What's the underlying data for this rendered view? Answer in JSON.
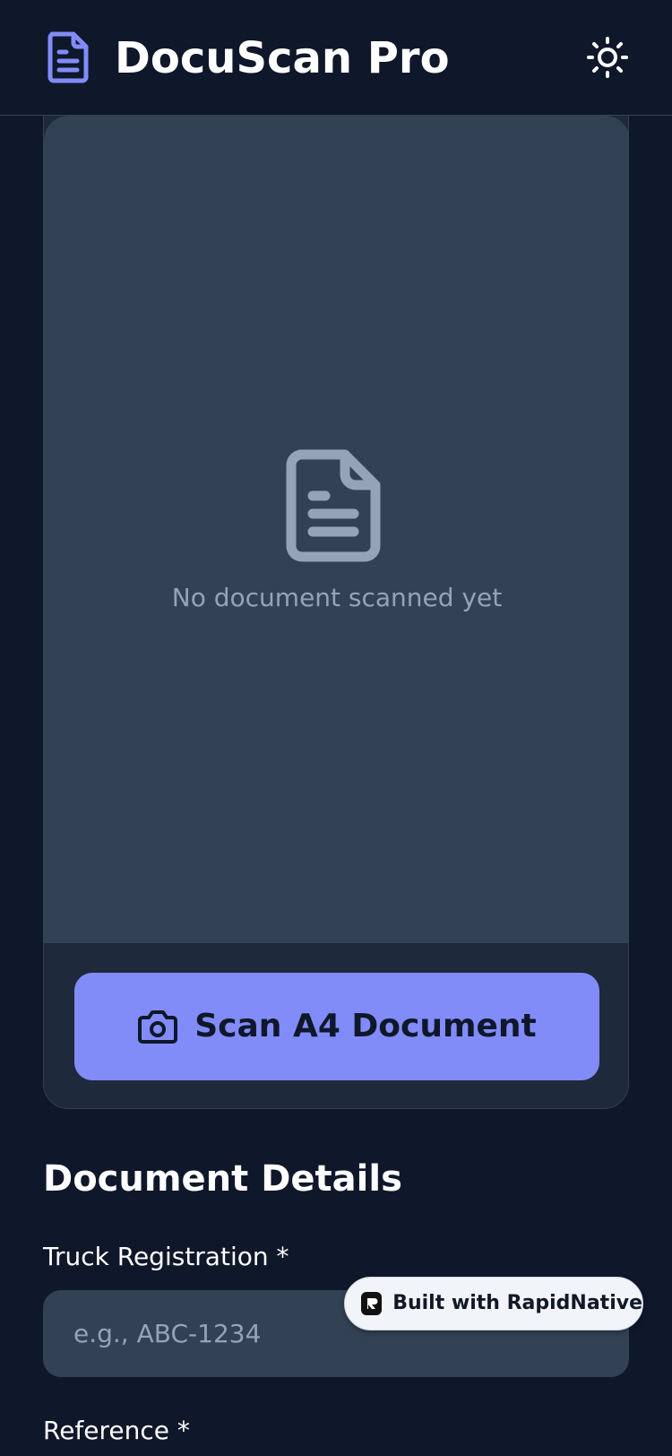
{
  "header": {
    "title": "DocuScan Pro",
    "logo_icon": "document-icon",
    "theme_icon": "sun-icon"
  },
  "scan_card": {
    "empty_icon": "document-icon",
    "empty_text": "No document scanned yet",
    "scan_button": {
      "icon": "camera-icon",
      "label": "Scan A4 Document"
    }
  },
  "details": {
    "title": "Document Details",
    "fields": [
      {
        "label": "Truck Registration *",
        "placeholder": "e.g., ABC-1234",
        "value": ""
      },
      {
        "label": "Reference *"
      }
    ]
  },
  "badge": {
    "label": "Built with RapidNative"
  },
  "colors": {
    "background": "#0f172a",
    "card": "#1e293b",
    "surface": "#334155",
    "accent": "#818cf8",
    "muted_text": "#94a3b8"
  }
}
